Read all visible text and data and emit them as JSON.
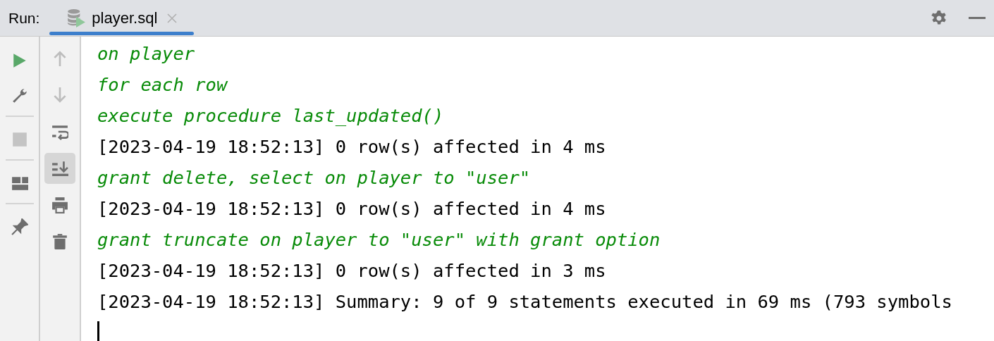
{
  "header": {
    "label": "Run:",
    "tabs": [
      {
        "label": "player.sql",
        "selected": true
      }
    ]
  },
  "left_toolbar": [
    {
      "kind": "run",
      "disabled": false
    },
    {
      "kind": "settings",
      "disabled": false
    },
    {
      "kind": "separator"
    },
    {
      "kind": "stop",
      "disabled": true
    },
    {
      "kind": "separator"
    },
    {
      "kind": "layout",
      "disabled": false
    },
    {
      "kind": "separator"
    },
    {
      "kind": "pin",
      "disabled": false
    }
  ],
  "console_toolbar": [
    {
      "kind": "up",
      "disabled": true,
      "on": false
    },
    {
      "kind": "down",
      "disabled": true,
      "on": false
    },
    {
      "kind": "wrap",
      "disabled": false,
      "on": false
    },
    {
      "kind": "scroll-end",
      "disabled": false,
      "on": true
    },
    {
      "kind": "print",
      "disabled": false,
      "on": false
    },
    {
      "kind": "trash",
      "disabled": false,
      "on": false
    }
  ],
  "console_lines": [
    {
      "kind": "statement",
      "text": "on player"
    },
    {
      "kind": "statement",
      "text": "for each row"
    },
    {
      "kind": "statement",
      "text": "execute procedure last_updated()"
    },
    {
      "kind": "log",
      "text": "[2023-04-19 18:52:13] 0 row(s) affected in 4 ms"
    },
    {
      "kind": "statement",
      "text": "grant delete, select on player to \"user\""
    },
    {
      "kind": "log",
      "text": "[2023-04-19 18:52:13] 0 row(s) affected in 4 ms"
    },
    {
      "kind": "statement",
      "text": "grant truncate on player to \"user\" with grant option"
    },
    {
      "kind": "log",
      "text": "[2023-04-19 18:52:13] 0 row(s) affected in 3 ms"
    },
    {
      "kind": "log",
      "text": "[2023-04-19 18:52:13] Summary: 9 of 9 statements executed in 69 ms (793 symbols"
    }
  ]
}
